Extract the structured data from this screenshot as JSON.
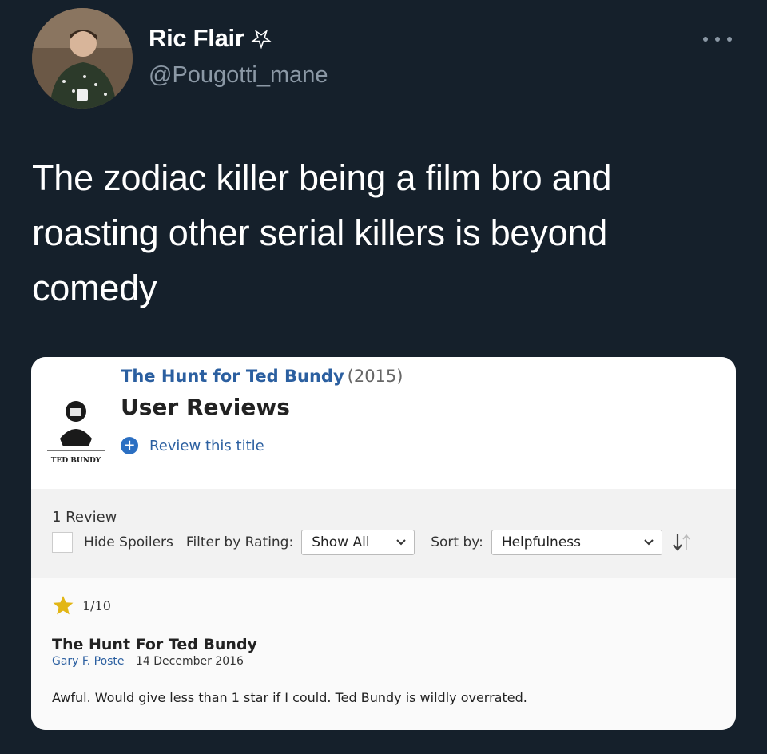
{
  "tweet": {
    "display_name": "Ric Flair",
    "name_badge_icon": "pentagram-icon",
    "handle": "@Pougotti_mane",
    "text": "The zodiac killer being a film bro and roasting other serial killers is beyond comedy",
    "more_icon": "more-dots-icon"
  },
  "card": {
    "movie_title": "The Hunt for Ted Bundy",
    "movie_year": "(2015)",
    "section_title": "User Reviews",
    "poster_caption": "TED BUNDY",
    "review_this_label": "Review this title",
    "review_count": "1 Review",
    "hide_spoilers_label": "Hide Spoilers",
    "filter_label": "Filter by Rating:",
    "filter_value": "Show All",
    "sort_label": "Sort by:",
    "sort_value": "Helpfulness",
    "review": {
      "rating": "1/10",
      "title": "The Hunt For Ted Bundy",
      "author": "Gary F. Poste",
      "date": "14 December 2016",
      "text": "Awful. Would give less than 1 star if I could. Ted Bundy is wildly overrated."
    }
  },
  "colors": {
    "background": "#15202b",
    "link": "#2b5fa0",
    "star": "#e2b616"
  }
}
